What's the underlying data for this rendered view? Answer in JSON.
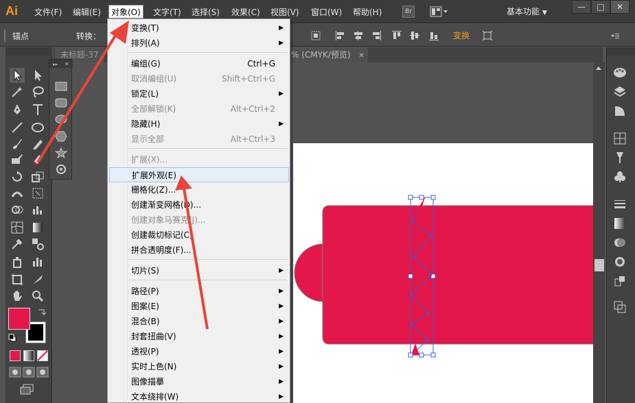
{
  "app": {
    "logo": "Ai",
    "workspace": "基本功能"
  },
  "menubar": {
    "items": [
      "文件(F)",
      "编辑(E)",
      "对象(O)",
      "文字(T)",
      "选择(S)",
      "效果(C)",
      "视图(V)",
      "窗口(W)",
      "帮助(H)"
    ],
    "bridge": "Br"
  },
  "window_buttons": {
    "minimize": "—",
    "maximize": "□",
    "close": "✕"
  },
  "controlbar": {
    "anchor": "锚点",
    "convert": "转换：",
    "transform": "变换"
  },
  "tabs": {
    "untitled": "未标题-37",
    "doc_info": "% (CMYK/预览)",
    "close": "✕"
  },
  "dropdown": {
    "items": [
      {
        "label": "变换(T)",
        "shortcut": "",
        "submenu": true,
        "disabled": false
      },
      {
        "label": "排列(A)",
        "shortcut": "",
        "submenu": true,
        "disabled": false
      },
      {
        "label": "编组(G)",
        "shortcut": "Ctrl+G",
        "submenu": false,
        "disabled": false
      },
      {
        "label": "取消编组(U)",
        "shortcut": "Shift+Ctrl+G",
        "submenu": false,
        "disabled": true
      },
      {
        "label": "锁定(L)",
        "shortcut": "",
        "submenu": true,
        "disabled": false
      },
      {
        "label": "全部解锁(K)",
        "shortcut": "Alt+Ctrl+2",
        "submenu": false,
        "disabled": true
      },
      {
        "label": "隐藏(H)",
        "shortcut": "",
        "submenu": true,
        "disabled": false
      },
      {
        "label": "显示全部",
        "shortcut": "Alt+Ctrl+3",
        "submenu": false,
        "disabled": true
      },
      {
        "label": "扩展(X)...",
        "shortcut": "",
        "submenu": false,
        "disabled": true
      },
      {
        "label": "扩展外观(E)",
        "shortcut": "",
        "submenu": false,
        "disabled": false,
        "highlighted": true
      },
      {
        "label": "栅格化(Z)...",
        "shortcut": "",
        "submenu": false,
        "disabled": false
      },
      {
        "label": "创建渐变网格(D)...",
        "shortcut": "",
        "submenu": false,
        "disabled": false
      },
      {
        "label": "创建对象马赛克(J)...",
        "shortcut": "",
        "submenu": false,
        "disabled": true
      },
      {
        "label": "创建裁切标记(C)",
        "shortcut": "",
        "submenu": false,
        "disabled": false
      },
      {
        "label": "拼合透明度(F)...",
        "shortcut": "",
        "submenu": false,
        "disabled": false
      },
      {
        "label": "切片(S)",
        "shortcut": "",
        "submenu": true,
        "disabled": false
      },
      {
        "label": "路径(P)",
        "shortcut": "",
        "submenu": true,
        "disabled": false
      },
      {
        "label": "图案(E)",
        "shortcut": "",
        "submenu": true,
        "disabled": false
      },
      {
        "label": "混合(B)",
        "shortcut": "",
        "submenu": true,
        "disabled": false
      },
      {
        "label": "封套扭曲(V)",
        "shortcut": "",
        "submenu": true,
        "disabled": false
      },
      {
        "label": "透视(P)",
        "shortcut": "",
        "submenu": true,
        "disabled": false
      },
      {
        "label": "实时上色(N)",
        "shortcut": "",
        "submenu": true,
        "disabled": false
      },
      {
        "label": "图像描摹",
        "shortcut": "",
        "submenu": true,
        "disabled": false
      },
      {
        "label": "文本绕排(W)",
        "shortcut": "",
        "submenu": true,
        "disabled": false
      }
    ],
    "submenu_arrow": "▶"
  },
  "colors": {
    "fill": "#e3174a",
    "accent": "#f39a1e",
    "arrow": "#e8443a",
    "selection": "#3a5bd9"
  }
}
